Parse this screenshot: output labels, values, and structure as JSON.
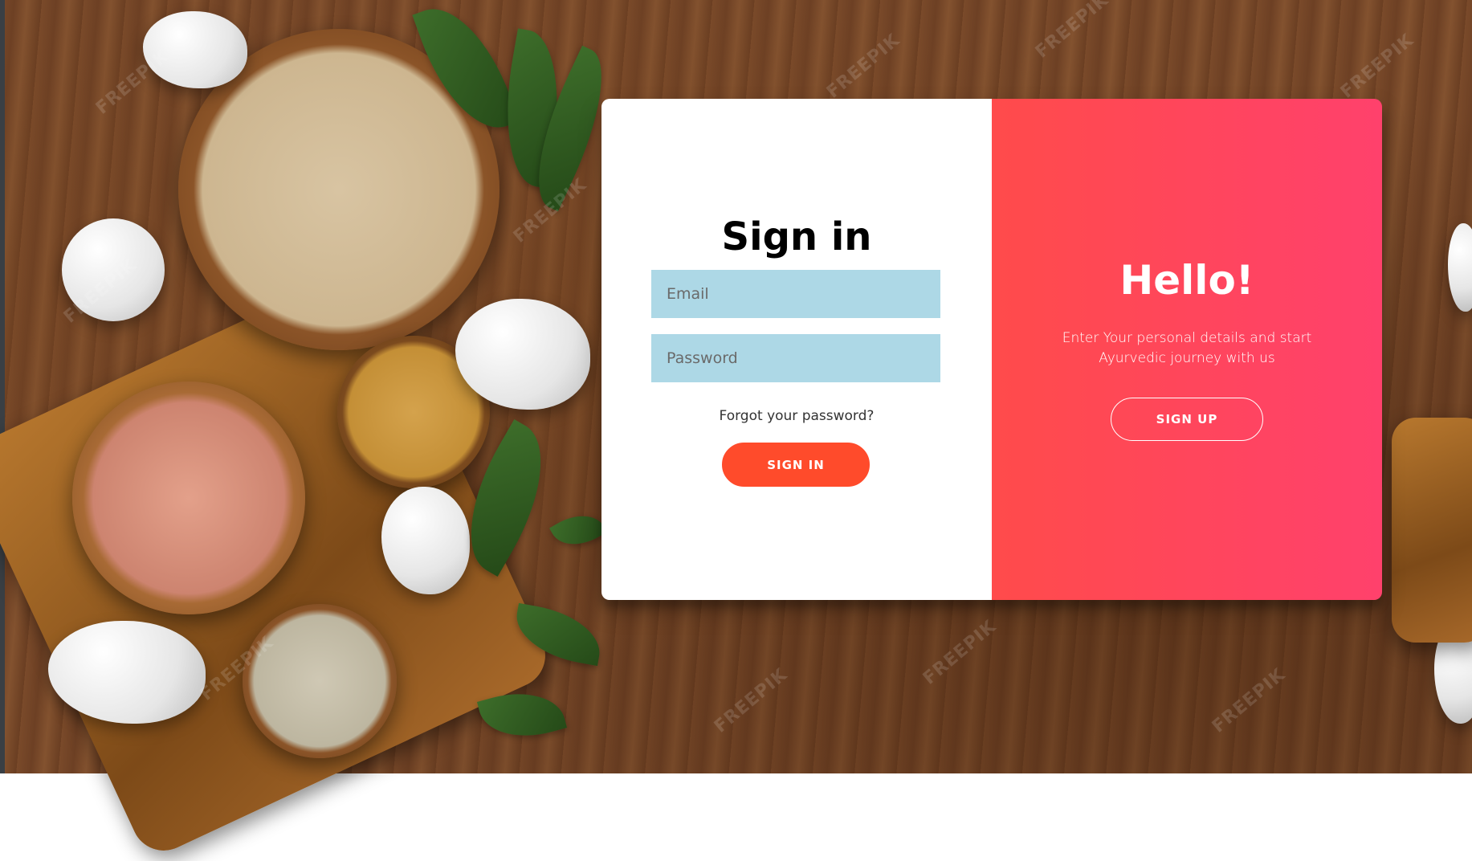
{
  "signin": {
    "title": "Sign in",
    "email_placeholder": "Email",
    "password_placeholder": "Password",
    "forgot_label": "Forgot your password?",
    "button_label": "SIGN IN"
  },
  "overlay": {
    "title": "Hello!",
    "text": "Enter Your personal details and start Ayurvedic journey with us",
    "button_label": "SIGN UP"
  },
  "background": {
    "watermark_text": "FREEPIK"
  },
  "colors": {
    "accent": "#ff4b2b",
    "overlay_start": "#ff4b4b",
    "overlay_end": "#ff416c",
    "input_bg": "#add8e6"
  }
}
